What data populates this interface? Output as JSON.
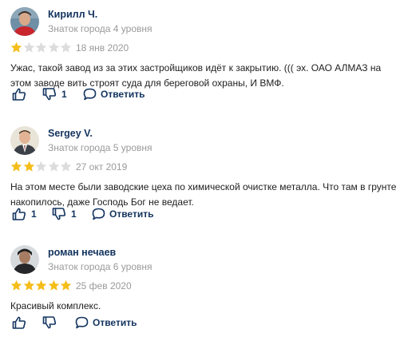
{
  "reviews": [
    {
      "author": "Кирилл Ч.",
      "level": "Знаток города 4 уровня",
      "rating": 1,
      "date": "18 янв 2020",
      "text": "Ужас, такой завод из за этих застройщиков идёт к закрытию. ((( эх. ОАО АЛМАЗ на этом заводе вить строят суда для береговой охраны, И ВМФ.",
      "likes": "",
      "dislikes": "1",
      "reply_label": "Ответить",
      "avatar_icon": "user-photo-red-shirt"
    },
    {
      "author": "Sergey V.",
      "level": "Знаток города 5 уровня",
      "rating": 2,
      "date": "27 окт 2019",
      "text": "На этом месте были заводские цеха по химической очистке металла. Что там в грунте накопилось, даже Господь Бог не ведает.",
      "likes": "1",
      "dislikes": "1",
      "reply_label": "Ответить",
      "avatar_icon": "user-photo-suit"
    },
    {
      "author": "роман нечаев",
      "level": "Знаток города 6 уровня",
      "rating": 5,
      "date": "25 фев 2020",
      "text": "Красивый комплекс.",
      "likes": "",
      "dislikes": "",
      "reply_label": "Ответить",
      "avatar_icon": "user-photo-dark-hood"
    }
  ],
  "colors": {
    "star_filled": "#f5bd1a",
    "star_empty": "#dcdcdc",
    "link": "#12335e",
    "muted": "#9a9a9a"
  }
}
